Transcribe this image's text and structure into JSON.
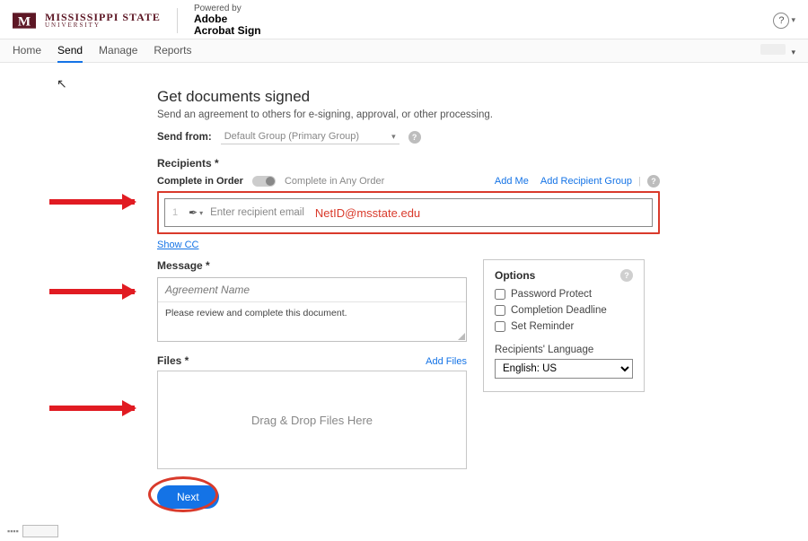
{
  "brand": {
    "logo_letter": "M",
    "univ_line1": "MISSISSIPPI STATE",
    "univ_line2": "UNIVERSITY",
    "powered": "Powered by",
    "adobe_l1": "Adobe",
    "adobe_l2": "Acrobat Sign"
  },
  "nav": {
    "home": "Home",
    "send": "Send",
    "manage": "Manage",
    "reports": "Reports"
  },
  "page": {
    "title": "Get documents signed",
    "subtitle": "Send an agreement to others for e-signing, approval, or other processing.",
    "sendfrom_label": "Send from:",
    "sendfrom_value": "Default Group (Primary Group)"
  },
  "recipients": {
    "label": "Recipients *",
    "complete_in_order": "Complete in Order",
    "complete_any_order": "Complete in Any Order",
    "add_me": "Add Me",
    "add_group": "Add Recipient Group",
    "row_num": "1",
    "placeholder": "Enter recipient email",
    "annotation": "NetID@msstate.edu",
    "show_cc": "Show CC"
  },
  "message": {
    "label": "Message *",
    "name_placeholder": "Agreement Name",
    "body": "Please review and complete this document."
  },
  "files": {
    "label": "Files *",
    "add": "Add Files",
    "drop": "Drag & Drop Files Here"
  },
  "options": {
    "title": "Options",
    "pw": "Password Protect",
    "deadline": "Completion Deadline",
    "reminder": "Set Reminder",
    "lang_label": "Recipients' Language",
    "lang_value": "English: US"
  },
  "actions": {
    "next": "Next"
  },
  "icons": {
    "questionmark": "?",
    "caret": "▾",
    "pen": "✒"
  }
}
